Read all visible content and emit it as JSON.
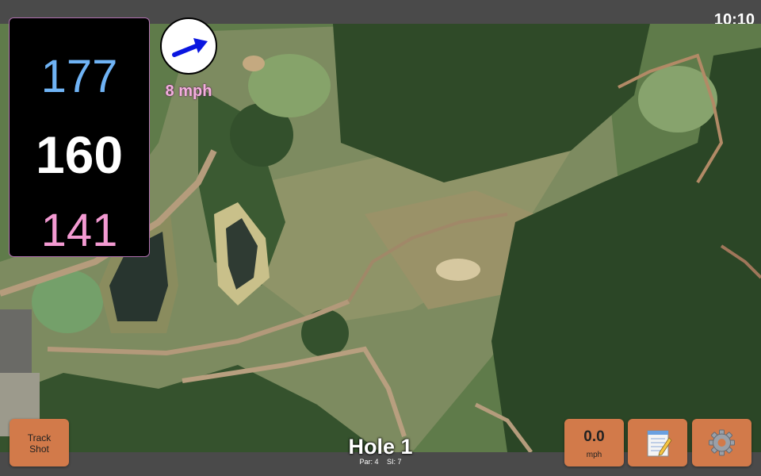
{
  "status": {
    "time": "10:10"
  },
  "distances": {
    "back": "177",
    "middle": "160",
    "front": "141"
  },
  "wind": {
    "speed": "8 mph",
    "icon": "wind-direction-arrow-icon"
  },
  "hole": {
    "title": "Hole 1",
    "par": "Par: 4",
    "si": "SI: 7"
  },
  "buttons": {
    "track_line1": "Track",
    "track_line2": "Shot",
    "speed_value": "0.0",
    "speed_unit": "mph",
    "notes_icon": "notepad-icon",
    "settings_icon": "gear-icon"
  },
  "colors": {
    "back": "#6fb3f5",
    "middle": "#ffffff",
    "front": "#f39ad2",
    "button": "#d27a4a",
    "wind_text": "#f3b0dd"
  }
}
